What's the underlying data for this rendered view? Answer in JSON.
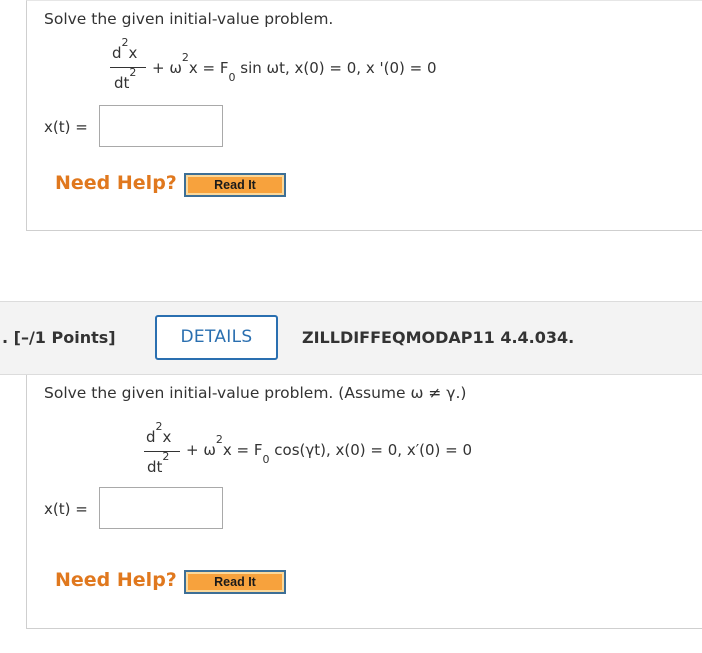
{
  "problem1": {
    "prompt": "Solve the given initial-value problem.",
    "numerator": "d",
    "numerator_sup": "2",
    "numerator_var": "x",
    "denominator": "dt",
    "denominator_sup": "2",
    "rhs_a": "+ ω",
    "rhs_a_sup": "2",
    "rhs_b": "x = F",
    "rhs_b_sub": "0",
    "rhs_c": " sin ωt,  x(0) = 0, x '(0) = 0",
    "answer_label": "x(t)  =",
    "answer_value": "",
    "need_help": "Need Help?",
    "read_it": "Read It"
  },
  "problem2": {
    "points": ". [–/1 Points]",
    "details": "DETAILS",
    "code": "ZILLDIFFEQMODAP11 4.4.034.",
    "prompt": "Solve the given initial-value problem. (Assume ω ≠ γ.)",
    "numerator": "d",
    "numerator_sup": "2",
    "numerator_var": "x",
    "denominator": "dt",
    "denominator_sup": "2",
    "rhs_a": "+ ω",
    "rhs_a_sup": "2",
    "rhs_b": "x = F",
    "rhs_b_sub": "0",
    "rhs_c": " cos(γt),  x(0) = 0,  x′(0) = 0",
    "answer_label": "x(t)  =",
    "answer_value": "",
    "need_help": "Need Help?",
    "read_it": "Read It"
  }
}
